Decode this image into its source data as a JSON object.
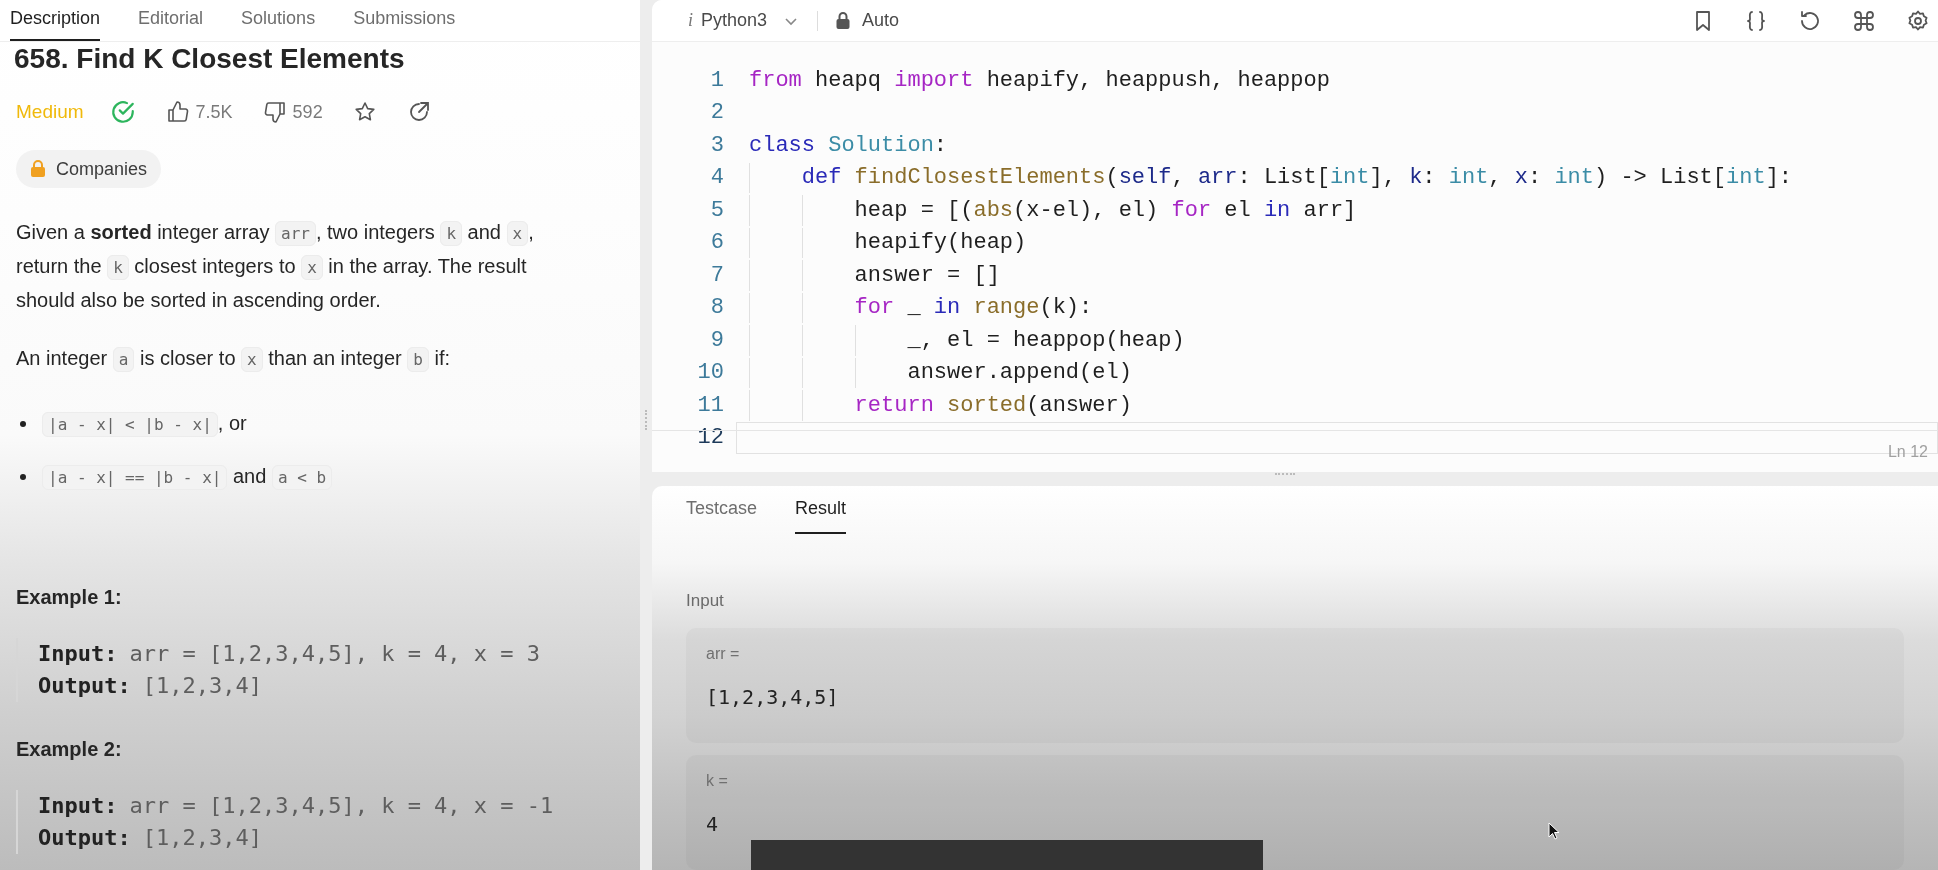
{
  "tabs": [
    {
      "label": "Description",
      "selected": true
    },
    {
      "label": "Editorial",
      "selected": false
    },
    {
      "label": "Solutions",
      "selected": false
    },
    {
      "label": "Submissions",
      "selected": false
    }
  ],
  "problem": {
    "title": "658. Find K Closest Elements",
    "difficulty": "Medium",
    "solved": true,
    "likes": "7.5K",
    "dislikes": "592",
    "companies": "Companies"
  },
  "description": [
    [
      {
        "kind": "text",
        "s": "Given a **sorted** integer array "
      },
      {
        "kind": "code",
        "s": "arr"
      },
      {
        "kind": "text",
        "s": ", two integers "
      },
      {
        "kind": "code",
        "s": "k"
      },
      {
        "kind": "text",
        "s": " and "
      },
      {
        "kind": "code",
        "s": "x"
      },
      {
        "kind": "text",
        "s": ", return the "
      },
      {
        "kind": "code",
        "s": "k"
      },
      {
        "kind": "text",
        "s": " closest integers to "
      },
      {
        "kind": "code",
        "s": "x"
      },
      {
        "kind": "text",
        "s": " in the array. The result should also be sorted in ascending order."
      }
    ],
    [
      {
        "kind": "text",
        "s": "An integer "
      },
      {
        "kind": "code",
        "s": "a"
      },
      {
        "kind": "text",
        "s": " is closer to "
      },
      {
        "kind": "code",
        "s": "x"
      },
      {
        "kind": "text",
        "s": " than an integer "
      },
      {
        "kind": "code",
        "s": "b"
      },
      {
        "kind": "text",
        "s": " if:"
      }
    ]
  ],
  "conditions": [
    [
      {
        "kind": "code",
        "s": "|a - x| < |b - x|"
      },
      {
        "kind": "text",
        "s": ", or"
      }
    ],
    [
      {
        "kind": "code",
        "s": "|a - x| == |b - x|"
      },
      {
        "kind": "text",
        "s": " and "
      },
      {
        "kind": "code",
        "s": "a < b"
      }
    ]
  ],
  "examples": [
    {
      "title": "Example 1:",
      "input_label": "Input:",
      "input": "arr = [1,2,3,4,5], k = 4, x = 3",
      "output_label": "Output:",
      "output": "[1,2,3,4]"
    },
    {
      "title": "Example 2:",
      "input_label": "Input:",
      "input": "arr = [1,2,3,4,5], k = 4, x = -1",
      "output_label": "Output:",
      "output": "[1,2,3,4]"
    }
  ],
  "editor": {
    "language_icon": "i",
    "language": "Python3",
    "mode": "Auto",
    "cursor_position": "Ln 12",
    "lines": [
      {
        "number": "1",
        "current": false,
        "tokens": [
          {
            "kind": "control",
            "text": "from"
          },
          {
            "kind": "plain",
            "text": " heapq "
          },
          {
            "kind": "control",
            "text": "import"
          },
          {
            "kind": "plain",
            "text": " heapify, heappush, heappop"
          }
        ]
      },
      {
        "number": "2",
        "current": false
      },
      {
        "number": "3",
        "current": false,
        "tokens": [
          {
            "kind": "keyword",
            "text": "class"
          },
          {
            "kind": "type",
            "text": " Solution"
          },
          {
            "kind": "plain",
            "text": ":"
          }
        ]
      },
      {
        "number": "4",
        "current": false,
        "tokens": [
          {
            "kind": "keyword",
            "text": "    def"
          },
          {
            "kind": "func",
            "text": " findClosestElements"
          },
          {
            "kind": "plain",
            "text": "("
          },
          {
            "kind": "param",
            "text": "self"
          },
          {
            "kind": "plain",
            "text": ", "
          },
          {
            "kind": "param",
            "text": "arr"
          },
          {
            "kind": "plain",
            "text": ": List["
          },
          {
            "kind": "type",
            "text": "int"
          },
          {
            "kind": "plain",
            "text": "], "
          },
          {
            "kind": "param",
            "text": "k"
          },
          {
            "kind": "plain",
            "text": ": "
          },
          {
            "kind": "type",
            "text": "int"
          },
          {
            "kind": "plain",
            "text": ", "
          },
          {
            "kind": "param",
            "text": "x"
          },
          {
            "kind": "plain",
            "text": ": "
          },
          {
            "kind": "type",
            "text": "int"
          },
          {
            "kind": "plain",
            "text": ") -> List["
          },
          {
            "kind": "type",
            "text": "int"
          },
          {
            "kind": "plain",
            "text": "]:"
          }
        ]
      },
      {
        "number": "5",
        "current": false,
        "tokens": [
          {
            "kind": "plain",
            "text": "        heap = [("
          },
          {
            "kind": "func",
            "text": "abs"
          },
          {
            "kind": "plain",
            "text": "(x-el), el) "
          },
          {
            "kind": "control",
            "text": "for"
          },
          {
            "kind": "plain",
            "text": " el "
          },
          {
            "kind": "keyword",
            "text": "in"
          },
          {
            "kind": "plain",
            "text": " arr]"
          }
        ]
      },
      {
        "number": "6",
        "current": false,
        "tokens": [
          {
            "kind": "plain",
            "text": "        heapify(heap)"
          }
        ]
      },
      {
        "number": "7",
        "current": false,
        "tokens": [
          {
            "kind": "plain",
            "text": "        answer = []"
          }
        ]
      },
      {
        "number": "8",
        "current": false,
        "tokens": [
          {
            "kind": "control",
            "text": "        for"
          },
          {
            "kind": "plain",
            "text": " _ "
          },
          {
            "kind": "keyword",
            "text": "in"
          },
          {
            "kind": "func",
            "text": " range"
          },
          {
            "kind": "plain",
            "text": "(k):"
          }
        ]
      },
      {
        "number": "9",
        "current": false,
        "tokens": [
          {
            "kind": "plain",
            "text": "            _, el = heappop(heap)"
          }
        ]
      },
      {
        "number": "10",
        "current": false,
        "tokens": [
          {
            "kind": "plain",
            "text": "            answer.append(el)"
          }
        ]
      },
      {
        "number": "11",
        "current": false,
        "tokens": [
          {
            "kind": "control",
            "text": "        return"
          },
          {
            "kind": "func",
            "text": " sorted"
          },
          {
            "kind": "plain",
            "text": "(answer)"
          }
        ]
      },
      {
        "number": "12",
        "current": true
      }
    ]
  },
  "console": {
    "tabs": [
      {
        "label": "Testcase",
        "selected": false
      },
      {
        "label": "Result",
        "selected": true
      }
    ],
    "input_label": "Input",
    "fields": [
      {
        "name": "arr =",
        "value": "[1,2,3,4,5]"
      },
      {
        "name": "k =",
        "value": "4"
      }
    ]
  }
}
